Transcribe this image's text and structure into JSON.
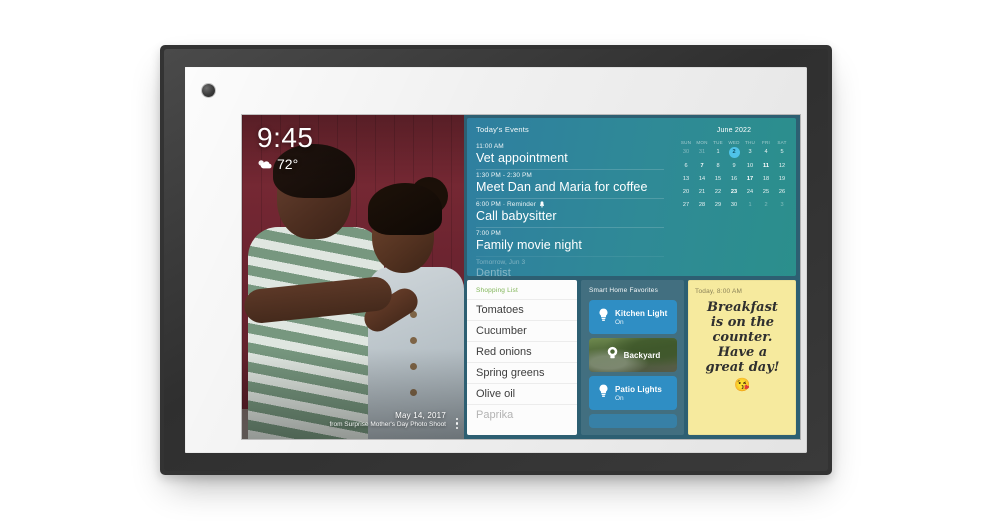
{
  "device": {
    "name": "smart-display"
  },
  "screen": {
    "photo": {
      "clock": "9:45",
      "weather_icon": "partly-cloudy-icon",
      "temperature": "72°",
      "caption_date": "May 14, 2017",
      "caption_source": "from Surprise Mother's Day Photo Shoot",
      "menu_icon": "more-vertical-icon"
    },
    "events": {
      "title": "Today's Events",
      "items": [
        {
          "time": "11:00 AM",
          "title": "Vet appointment",
          "icon": "",
          "faded": false
        },
        {
          "time": "1:30 PM - 2:30 PM",
          "title": "Meet Dan and Maria for coffee",
          "icon": "",
          "faded": false
        },
        {
          "time": "6:00 PM · Reminder",
          "title": "Call babysitter",
          "icon": "bell-icon",
          "faded": false
        },
        {
          "time": "7:00 PM",
          "title": "Family movie night",
          "icon": "",
          "faded": false
        },
        {
          "time": "Tomorrow, Jun 3",
          "title": "Dentist",
          "icon": "",
          "faded": true
        }
      ]
    },
    "calendar": {
      "month": "June 2022",
      "dow": [
        "Sun",
        "Mon",
        "Tue",
        "Wed",
        "Thu",
        "Fri",
        "Sat"
      ],
      "weeks": [
        [
          {
            "d": "30",
            "muted": true,
            "bold": false,
            "today": false
          },
          {
            "d": "31",
            "muted": true,
            "bold": false,
            "today": false
          },
          {
            "d": "1",
            "muted": false,
            "bold": false,
            "today": false
          },
          {
            "d": "2",
            "muted": false,
            "bold": true,
            "today": true
          },
          {
            "d": "3",
            "muted": false,
            "bold": false,
            "today": false
          },
          {
            "d": "4",
            "muted": false,
            "bold": false,
            "today": false
          },
          {
            "d": "5",
            "muted": false,
            "bold": false,
            "today": false
          }
        ],
        [
          {
            "d": "6",
            "muted": false,
            "bold": false,
            "today": false
          },
          {
            "d": "7",
            "muted": false,
            "bold": true,
            "today": false
          },
          {
            "d": "8",
            "muted": false,
            "bold": false,
            "today": false
          },
          {
            "d": "9",
            "muted": false,
            "bold": false,
            "today": false
          },
          {
            "d": "10",
            "muted": false,
            "bold": false,
            "today": false
          },
          {
            "d": "11",
            "muted": false,
            "bold": true,
            "today": false
          },
          {
            "d": "12",
            "muted": false,
            "bold": false,
            "today": false
          }
        ],
        [
          {
            "d": "13",
            "muted": false,
            "bold": false,
            "today": false
          },
          {
            "d": "14",
            "muted": false,
            "bold": false,
            "today": false
          },
          {
            "d": "15",
            "muted": false,
            "bold": false,
            "today": false
          },
          {
            "d": "16",
            "muted": false,
            "bold": false,
            "today": false
          },
          {
            "d": "17",
            "muted": false,
            "bold": true,
            "today": false
          },
          {
            "d": "18",
            "muted": false,
            "bold": false,
            "today": false
          },
          {
            "d": "19",
            "muted": false,
            "bold": false,
            "today": false
          }
        ],
        [
          {
            "d": "20",
            "muted": false,
            "bold": false,
            "today": false
          },
          {
            "d": "21",
            "muted": false,
            "bold": false,
            "today": false
          },
          {
            "d": "22",
            "muted": false,
            "bold": false,
            "today": false
          },
          {
            "d": "23",
            "muted": false,
            "bold": true,
            "today": false
          },
          {
            "d": "24",
            "muted": false,
            "bold": false,
            "today": false
          },
          {
            "d": "25",
            "muted": false,
            "bold": false,
            "today": false
          },
          {
            "d": "26",
            "muted": false,
            "bold": false,
            "today": false
          }
        ],
        [
          {
            "d": "27",
            "muted": false,
            "bold": false,
            "today": false
          },
          {
            "d": "28",
            "muted": false,
            "bold": false,
            "today": false
          },
          {
            "d": "29",
            "muted": false,
            "bold": false,
            "today": false
          },
          {
            "d": "30",
            "muted": false,
            "bold": false,
            "today": false
          },
          {
            "d": "1",
            "muted": true,
            "bold": false,
            "today": false
          },
          {
            "d": "2",
            "muted": true,
            "bold": false,
            "today": false
          },
          {
            "d": "3",
            "muted": true,
            "bold": false,
            "today": false
          }
        ]
      ]
    },
    "shopping": {
      "title": "Shopping List",
      "items": [
        {
          "label": "Tomatoes",
          "faded": false
        },
        {
          "label": "Cucumber",
          "faded": false
        },
        {
          "label": "Red onions",
          "faded": false
        },
        {
          "label": "Spring greens",
          "faded": false
        },
        {
          "label": "Olive oil",
          "faded": false
        },
        {
          "label": "Paprika",
          "faded": true
        }
      ]
    },
    "smart_home": {
      "title": "Smart Home Favorites",
      "tiles": [
        {
          "name": "Kitchen Light",
          "state": "On",
          "icon": "lightbulb-icon",
          "kind": "light"
        },
        {
          "name": "Backyard",
          "state": "",
          "icon": "camera-icon",
          "kind": "camera"
        },
        {
          "name": "Patio Lights",
          "state": "On",
          "icon": "lightbulb-icon",
          "kind": "light"
        },
        {
          "name": "",
          "state": "",
          "icon": "",
          "kind": "partial"
        }
      ]
    },
    "note": {
      "time": "Today, 8:00 AM",
      "line1": "Breakfast",
      "line2": "is on the",
      "line3": "counter.",
      "line4": "Have a",
      "line5": "great day!",
      "emoji": "😘"
    }
  },
  "colors": {
    "frame": "#333333",
    "bezel": "#ebebeb",
    "events_teal": "#2f8a96",
    "tile_blue": "#2f8ec4",
    "note_yellow": "#f6ea9e",
    "shopping_green": "#7db353",
    "today_highlight": "#4fc3e8"
  }
}
